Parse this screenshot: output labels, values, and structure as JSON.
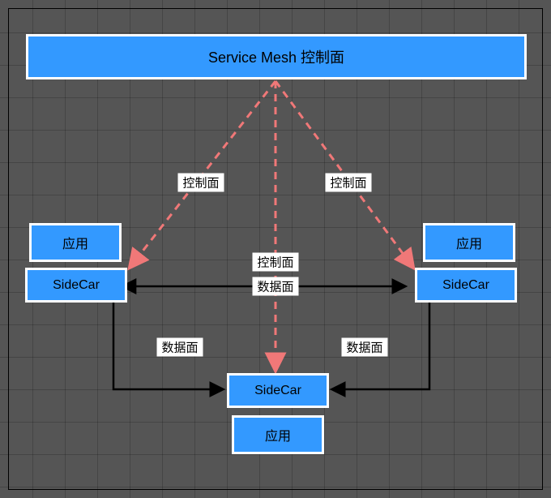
{
  "diagram": {
    "topTitle": "Service Mesh 控制面",
    "nodes": {
      "app_left": "应用",
      "sidecar_left": "SideCar",
      "app_right": "应用",
      "sidecar_right": "SideCar",
      "sidecar_bottom": "SideCar",
      "app_bottom": "应用"
    },
    "labels": {
      "ctrl_left": "控制面",
      "ctrl_right": "控制面",
      "ctrl_mid": "控制面",
      "data_mid": "数据面",
      "data_left": "数据面",
      "data_right": "数据面"
    },
    "colors": {
      "node_fill": "#3399ff",
      "node_border": "#ffffff",
      "bg": "#555555",
      "ctrl_arrow": "#f07878",
      "data_arrow": "#000000"
    }
  }
}
